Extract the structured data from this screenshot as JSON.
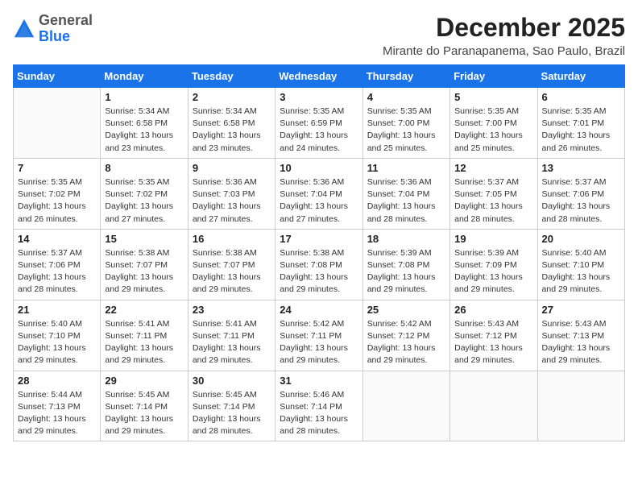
{
  "header": {
    "logo_general": "General",
    "logo_blue": "Blue",
    "month_year": "December 2025",
    "location": "Mirante do Paranapanema, Sao Paulo, Brazil"
  },
  "weekdays": [
    "Sunday",
    "Monday",
    "Tuesday",
    "Wednesday",
    "Thursday",
    "Friday",
    "Saturday"
  ],
  "weeks": [
    [
      {
        "day": "",
        "info": ""
      },
      {
        "day": "1",
        "info": "Sunrise: 5:34 AM\nSunset: 6:58 PM\nDaylight: 13 hours\nand 23 minutes."
      },
      {
        "day": "2",
        "info": "Sunrise: 5:34 AM\nSunset: 6:58 PM\nDaylight: 13 hours\nand 23 minutes."
      },
      {
        "day": "3",
        "info": "Sunrise: 5:35 AM\nSunset: 6:59 PM\nDaylight: 13 hours\nand 24 minutes."
      },
      {
        "day": "4",
        "info": "Sunrise: 5:35 AM\nSunset: 7:00 PM\nDaylight: 13 hours\nand 25 minutes."
      },
      {
        "day": "5",
        "info": "Sunrise: 5:35 AM\nSunset: 7:00 PM\nDaylight: 13 hours\nand 25 minutes."
      },
      {
        "day": "6",
        "info": "Sunrise: 5:35 AM\nSunset: 7:01 PM\nDaylight: 13 hours\nand 26 minutes."
      }
    ],
    [
      {
        "day": "7",
        "info": "Sunrise: 5:35 AM\nSunset: 7:02 PM\nDaylight: 13 hours\nand 26 minutes."
      },
      {
        "day": "8",
        "info": "Sunrise: 5:35 AM\nSunset: 7:02 PM\nDaylight: 13 hours\nand 27 minutes."
      },
      {
        "day": "9",
        "info": "Sunrise: 5:36 AM\nSunset: 7:03 PM\nDaylight: 13 hours\nand 27 minutes."
      },
      {
        "day": "10",
        "info": "Sunrise: 5:36 AM\nSunset: 7:04 PM\nDaylight: 13 hours\nand 27 minutes."
      },
      {
        "day": "11",
        "info": "Sunrise: 5:36 AM\nSunset: 7:04 PM\nDaylight: 13 hours\nand 28 minutes."
      },
      {
        "day": "12",
        "info": "Sunrise: 5:37 AM\nSunset: 7:05 PM\nDaylight: 13 hours\nand 28 minutes."
      },
      {
        "day": "13",
        "info": "Sunrise: 5:37 AM\nSunset: 7:06 PM\nDaylight: 13 hours\nand 28 minutes."
      }
    ],
    [
      {
        "day": "14",
        "info": "Sunrise: 5:37 AM\nSunset: 7:06 PM\nDaylight: 13 hours\nand 28 minutes."
      },
      {
        "day": "15",
        "info": "Sunrise: 5:38 AM\nSunset: 7:07 PM\nDaylight: 13 hours\nand 29 minutes."
      },
      {
        "day": "16",
        "info": "Sunrise: 5:38 AM\nSunset: 7:07 PM\nDaylight: 13 hours\nand 29 minutes."
      },
      {
        "day": "17",
        "info": "Sunrise: 5:38 AM\nSunset: 7:08 PM\nDaylight: 13 hours\nand 29 minutes."
      },
      {
        "day": "18",
        "info": "Sunrise: 5:39 AM\nSunset: 7:08 PM\nDaylight: 13 hours\nand 29 minutes."
      },
      {
        "day": "19",
        "info": "Sunrise: 5:39 AM\nSunset: 7:09 PM\nDaylight: 13 hours\nand 29 minutes."
      },
      {
        "day": "20",
        "info": "Sunrise: 5:40 AM\nSunset: 7:10 PM\nDaylight: 13 hours\nand 29 minutes."
      }
    ],
    [
      {
        "day": "21",
        "info": "Sunrise: 5:40 AM\nSunset: 7:10 PM\nDaylight: 13 hours\nand 29 minutes."
      },
      {
        "day": "22",
        "info": "Sunrise: 5:41 AM\nSunset: 7:11 PM\nDaylight: 13 hours\nand 29 minutes."
      },
      {
        "day": "23",
        "info": "Sunrise: 5:41 AM\nSunset: 7:11 PM\nDaylight: 13 hours\nand 29 minutes."
      },
      {
        "day": "24",
        "info": "Sunrise: 5:42 AM\nSunset: 7:11 PM\nDaylight: 13 hours\nand 29 minutes."
      },
      {
        "day": "25",
        "info": "Sunrise: 5:42 AM\nSunset: 7:12 PM\nDaylight: 13 hours\nand 29 minutes."
      },
      {
        "day": "26",
        "info": "Sunrise: 5:43 AM\nSunset: 7:12 PM\nDaylight: 13 hours\nand 29 minutes."
      },
      {
        "day": "27",
        "info": "Sunrise: 5:43 AM\nSunset: 7:13 PM\nDaylight: 13 hours\nand 29 minutes."
      }
    ],
    [
      {
        "day": "28",
        "info": "Sunrise: 5:44 AM\nSunset: 7:13 PM\nDaylight: 13 hours\nand 29 minutes."
      },
      {
        "day": "29",
        "info": "Sunrise: 5:45 AM\nSunset: 7:14 PM\nDaylight: 13 hours\nand 29 minutes."
      },
      {
        "day": "30",
        "info": "Sunrise: 5:45 AM\nSunset: 7:14 PM\nDaylight: 13 hours\nand 28 minutes."
      },
      {
        "day": "31",
        "info": "Sunrise: 5:46 AM\nSunset: 7:14 PM\nDaylight: 13 hours\nand 28 minutes."
      },
      {
        "day": "",
        "info": ""
      },
      {
        "day": "",
        "info": ""
      },
      {
        "day": "",
        "info": ""
      }
    ]
  ]
}
